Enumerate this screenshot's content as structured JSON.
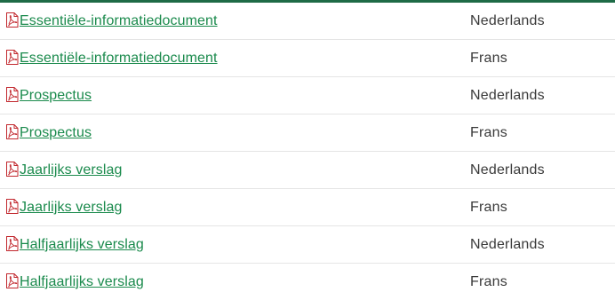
{
  "documents": [
    {
      "title": "Essentiële-informatiedocument",
      "language": "Nederlands",
      "icon": "pdf-icon"
    },
    {
      "title": "Essentiële-informatiedocument",
      "language": "Frans",
      "icon": "pdf-icon"
    },
    {
      "title": "Prospectus",
      "language": "Nederlands",
      "icon": "pdf-icon"
    },
    {
      "title": "Prospectus",
      "language": "Frans",
      "icon": "pdf-icon"
    },
    {
      "title": "Jaarlijks verslag",
      "language": "Nederlands",
      "icon": "pdf-icon"
    },
    {
      "title": "Jaarlijks verslag",
      "language": "Frans",
      "icon": "pdf-icon"
    },
    {
      "title": "Halfjaarlijks verslag",
      "language": "Nederlands",
      "icon": "pdf-icon"
    },
    {
      "title": "Halfjaarlijks verslag",
      "language": "Frans",
      "icon": "pdf-icon"
    }
  ],
  "colors": {
    "accent_bar": "#1e6b46",
    "link": "#1a8a4c",
    "pdf_icon": "#c1272d"
  }
}
